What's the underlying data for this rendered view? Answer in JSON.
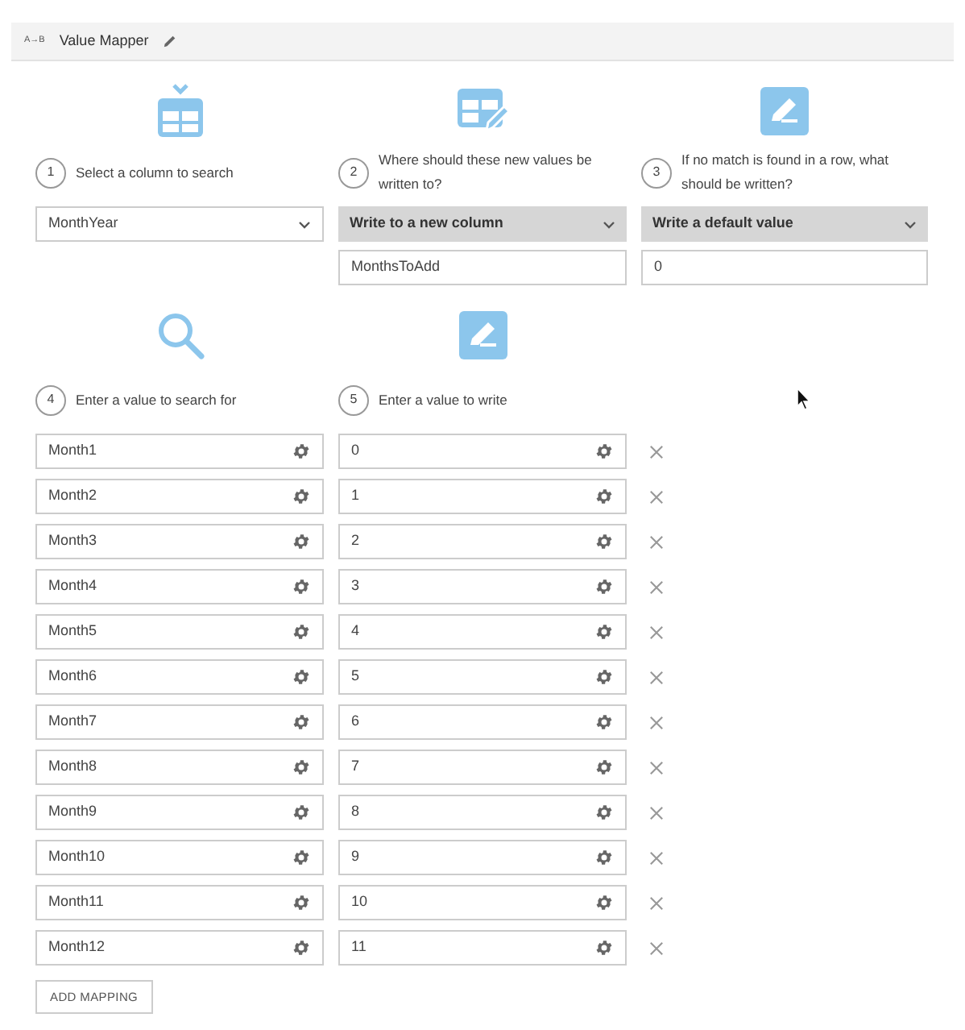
{
  "header": {
    "badge": "A→B",
    "title": "Value Mapper"
  },
  "steps": [
    {
      "number": "1",
      "label": "Select a column to search",
      "select": {
        "value": "MonthYear",
        "kind": "plain"
      }
    },
    {
      "number": "2",
      "label": "Where should these new values be written to?",
      "select": {
        "value": "Write to a new column",
        "kind": "filled"
      },
      "input": {
        "value": "MonthsToAdd"
      }
    },
    {
      "number": "3",
      "label": "If no match is found in a row, what should be written?",
      "select": {
        "value": "Write a default value",
        "kind": "filled"
      },
      "input": {
        "value": "0"
      }
    }
  ],
  "mapping_headers": [
    {
      "number": "4",
      "label": "Enter a value to search for"
    },
    {
      "number": "5",
      "label": "Enter a value to write"
    }
  ],
  "mappings": [
    {
      "search": "Month1",
      "write": "0"
    },
    {
      "search": "Month2",
      "write": "1"
    },
    {
      "search": "Month3",
      "write": "2"
    },
    {
      "search": "Month4",
      "write": "3"
    },
    {
      "search": "Month5",
      "write": "4"
    },
    {
      "search": "Month6",
      "write": "5"
    },
    {
      "search": "Month7",
      "write": "6"
    },
    {
      "search": "Month8",
      "write": "7"
    },
    {
      "search": "Month9",
      "write": "8"
    },
    {
      "search": "Month10",
      "write": "9"
    },
    {
      "search": "Month11",
      "write": "10"
    },
    {
      "search": "Month12",
      "write": "11"
    }
  ],
  "add_button": "ADD MAPPING"
}
